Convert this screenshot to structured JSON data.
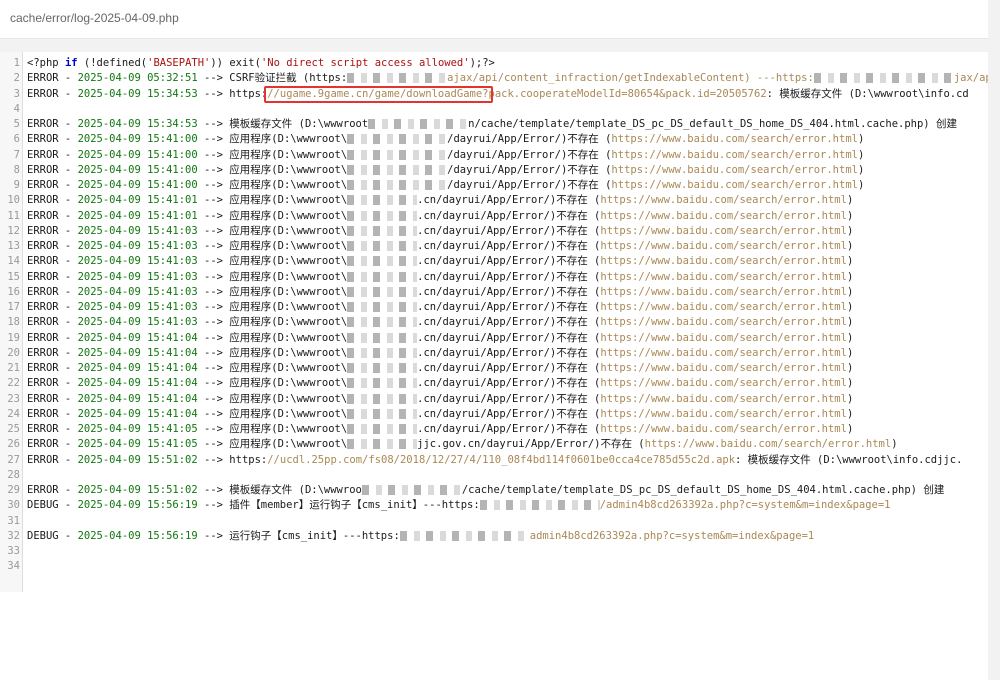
{
  "tab": {
    "path": "cache/error/log-2025-04-09.php"
  },
  "colors": {
    "keyword": "#0000cc",
    "string": "#aa1111",
    "datetime": "#117711",
    "url": "#aa8855",
    "highlight": "#e3342f"
  },
  "line_numbers": [
    "1",
    "2",
    "3",
    "4",
    "5",
    "6",
    "7",
    "8",
    "9",
    "10",
    "11",
    "12",
    "13",
    "14",
    "15",
    "16",
    "17",
    "18",
    "19",
    "20",
    "21",
    "22",
    "23",
    "24",
    "25",
    "26",
    "27",
    "28",
    "29",
    "30",
    "31",
    "32",
    "33",
    "34"
  ],
  "code": {
    "l1": {
      "a": "<?php ",
      "kw": "if",
      "b": " (!defined(",
      "s1": "'BASEPATH'",
      "c": ")) exit(",
      "s2": "'No direct script access allowed'",
      "d": ");?>"
    },
    "l2": {
      "level": "ERROR - ",
      "dt": "2025-04-09 05:32:51",
      "msg": " --> CSRF验证拦截 (https:",
      "rest": "ajax/api/content_infraction/getIndexableContent) ---https:",
      "tail": "jax/ap"
    },
    "l3": {
      "level": "ERROR - ",
      "dt": "2025-04-09 15:34:53",
      "msg": " --> https:",
      "url_hl": "//ugame.9game.cn/game/downloadGame?",
      "url_rest": "pack.cooperateModelId=80654&pack.id=20505762",
      "tail": ": 模板缓存文件 (D:\\wwwroot\\info.cd"
    },
    "l5": {
      "level": "ERROR - ",
      "dt": "2025-04-09 15:34:53",
      "msg": " --> 模板缓存文件 (D:\\wwwroot",
      "rest": "n/cache/template/template_DS_pc_DS_default_DS_home_DS_404.html.cache.php) 创建"
    },
    "app_lines": {
      "pre": " --> 应用程序(D:\\wwwroot\\",
      "post": "/dayrui/App/Error/)不存在 (",
      "url": "https://www.baidu.com/search/error.html",
      "close": ")",
      "rows": [
        {
          "dt": "2025-04-09 15:41:00",
          "mid": ""
        },
        {
          "dt": "2025-04-09 15:41:00",
          "mid": ""
        },
        {
          "dt": "2025-04-09 15:41:00",
          "mid": ""
        },
        {
          "dt": "2025-04-09 15:41:00",
          "mid": ""
        },
        {
          "dt": "2025-04-09 15:41:01",
          "mid": ".cn"
        },
        {
          "dt": "2025-04-09 15:41:01",
          "mid": ".cn"
        },
        {
          "dt": "2025-04-09 15:41:03",
          "mid": ".cn"
        },
        {
          "dt": "2025-04-09 15:41:03",
          "mid": ".cn"
        },
        {
          "dt": "2025-04-09 15:41:03",
          "mid": ".cn"
        },
        {
          "dt": "2025-04-09 15:41:03",
          "mid": ".cn"
        },
        {
          "dt": "2025-04-09 15:41:03",
          "mid": ".cn"
        },
        {
          "dt": "2025-04-09 15:41:03",
          "mid": ".cn"
        },
        {
          "dt": "2025-04-09 15:41:03",
          "mid": ".cn"
        },
        {
          "dt": "2025-04-09 15:41:04",
          "mid": ".cn"
        },
        {
          "dt": "2025-04-09 15:41:04",
          "mid": ".cn"
        },
        {
          "dt": "2025-04-09 15:41:04",
          "mid": ".cn"
        },
        {
          "dt": "2025-04-09 15:41:04",
          "mid": ".cn"
        },
        {
          "dt": "2025-04-09 15:41:04",
          "mid": ".cn"
        },
        {
          "dt": "2025-04-09 15:41:04",
          "mid": ".cn"
        },
        {
          "dt": "2025-04-09 15:41:05",
          "mid": ".cn"
        },
        {
          "dt": "2025-04-09 15:41:05",
          "mid": "jjc.gov.cn"
        }
      ]
    },
    "l27": {
      "level": "ERROR - ",
      "dt": "2025-04-09 15:51:02",
      "msg": " --> https:",
      "url": "//ucdl.25pp.com/fs08/2018/12/27/4/110_08f4bd114f0601be0cca4ce785d55c2d.apk",
      "tail": ": 模板缓存文件 (D:\\wwwroot\\info.cdjjc."
    },
    "l29": {
      "level": "ERROR - ",
      "dt": "2025-04-09 15:51:02",
      "msg": " --> 模板缓存文件 (D:\\wwwroo",
      "rest": "/cache/template/template_DS_pc_DS_default_DS_home_DS_404.html.cache.php) 创建"
    },
    "l30": {
      "level": "DEBUG - ",
      "dt": "2025-04-09 15:56:19",
      "msg": " --> 插件【member】运行钩子【cms_init】---https:",
      "url": "/admin4b8cd263392a.php?c=system&m=index&page=1"
    },
    "l32": {
      "level": "DEBUG - ",
      "dt": "2025-04-09 15:56:19",
      "msg": " --> 运行钩子【cms_init】---https:",
      "url": "admin4b8cd263392a.php?c=system&m=index&page=1"
    }
  }
}
